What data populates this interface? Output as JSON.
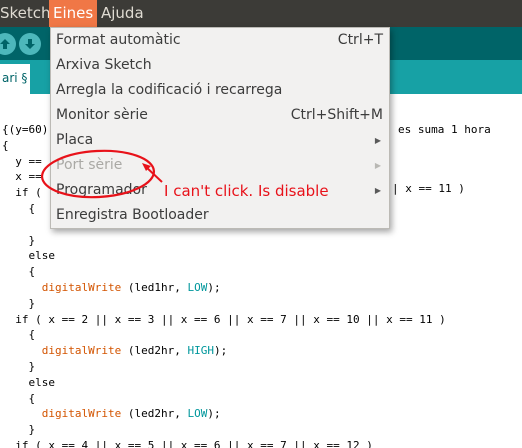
{
  "menubar": {
    "items": [
      {
        "label": "Sketch",
        "active": false
      },
      {
        "label": "Eines",
        "active": true
      },
      {
        "label": "Ajuda",
        "active": false
      }
    ]
  },
  "toolbar": {
    "buttons": [
      {
        "icon": "open-arrow-up-icon"
      },
      {
        "icon": "save-arrow-down-icon"
      }
    ]
  },
  "tab": {
    "label": "ari §"
  },
  "editor": {
    "lines": [
      [
        {
          "t": "{(y=60)"
        }
      ],
      [
        {
          "t": "{"
        }
      ],
      [
        {
          "t": "  y == "
        }
      ],
      [
        {
          "t": "  x == "
        }
      ],
      [
        {
          "t": "  if ( "
        }
      ],
      [
        {
          "t": "    {"
        }
      ],
      [
        {
          "t": ""
        }
      ],
      [
        {
          "t": "    }"
        }
      ],
      [
        {
          "t": "    else"
        }
      ],
      [
        {
          "t": "    {"
        }
      ],
      [
        {
          "t": "      "
        },
        {
          "t": "digitalWrite",
          "c": "fn"
        },
        {
          "t": " (led1hr, "
        },
        {
          "t": "LOW",
          "c": "kw"
        },
        {
          "t": ");"
        }
      ],
      [
        {
          "t": "    }"
        }
      ],
      [
        {
          "t": "  if ( x == 2 || x == 3 || x == 6 || x == 7 || x == 10 || x == 11 )"
        }
      ],
      [
        {
          "t": "    {"
        }
      ],
      [
        {
          "t": "      "
        },
        {
          "t": "digitalWrite",
          "c": "fn"
        },
        {
          "t": " (led2hr, "
        },
        {
          "t": "HIGH",
          "c": "kw"
        },
        {
          "t": ");"
        }
      ],
      [
        {
          "t": "    }"
        }
      ],
      [
        {
          "t": "    else"
        }
      ],
      [
        {
          "t": "    {"
        }
      ],
      [
        {
          "t": "      "
        },
        {
          "t": "digitalWrite",
          "c": "fn"
        },
        {
          "t": " (led2hr, "
        },
        {
          "t": "LOW",
          "c": "kw"
        },
        {
          "t": ");"
        }
      ],
      [
        {
          "t": "    }"
        }
      ],
      [
        {
          "t": "  if ( x == 4 || x == 5 || x == 6 || x == 7 || x == 12 )"
        }
      ],
      [
        {
          "t": "    {"
        }
      ]
    ],
    "behind_menu": {
      "comment_fragment": "es suma 1 hora",
      "condition_fragment": "| x == 11 )"
    }
  },
  "tools_menu": {
    "items": [
      {
        "label": "Format automàtic",
        "shortcut": "Ctrl+T",
        "submenu": false,
        "disabled": false
      },
      {
        "label": "Arxiva Sketch",
        "shortcut": "",
        "submenu": false,
        "disabled": false
      },
      {
        "label": "Arregla la codificació i recarrega",
        "shortcut": "",
        "submenu": false,
        "disabled": false
      },
      {
        "label": "Monitor sèrie",
        "shortcut": "Ctrl+Shift+M",
        "submenu": false,
        "disabled": false
      },
      {
        "label": "Placa",
        "shortcut": "",
        "submenu": true,
        "disabled": false
      },
      {
        "label": "Port sèrie",
        "shortcut": "",
        "submenu": true,
        "disabled": true
      },
      {
        "label": "Programador",
        "shortcut": "",
        "submenu": true,
        "disabled": false
      },
      {
        "label": "Enregistra Bootloader",
        "shortcut": "",
        "submenu": false,
        "disabled": false
      }
    ]
  },
  "annotation": {
    "text": "I can't click. Is disable",
    "color": "#e8121a"
  },
  "colors": {
    "menubar_bg": "#3c3b37",
    "menu_active": "#f07746",
    "toolbar_bg": "#006468",
    "tabbar_bg": "#17a1a5",
    "function_color": "#d35400",
    "keyword_color": "#00979c"
  }
}
